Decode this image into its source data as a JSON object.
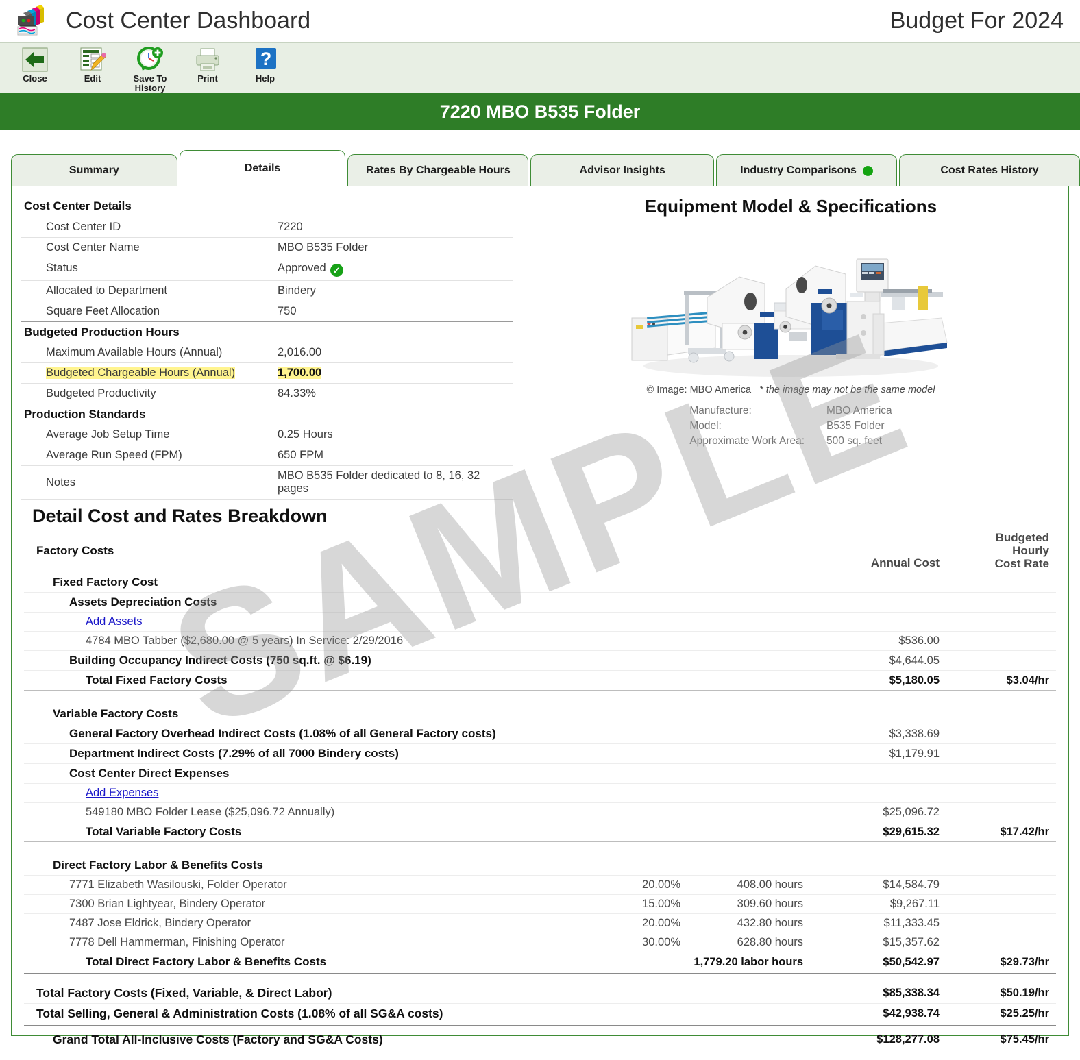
{
  "header": {
    "app_title": "Cost Center Dashboard",
    "budget_title": "Budget For 2024",
    "logo_icon": "printer-cartridges-icon"
  },
  "toolbar": {
    "buttons": [
      {
        "label": "Close",
        "icon": "back-arrow-icon"
      },
      {
        "label": "Edit",
        "icon": "form-pencil-icon"
      },
      {
        "label": "Save To",
        "label2": "History",
        "icon": "clock-plus-icon"
      },
      {
        "label": "Print",
        "icon": "printer-icon"
      },
      {
        "label": "Help",
        "icon": "question-mark-icon"
      }
    ]
  },
  "banner": {
    "title": "7220  MBO B535 Folder"
  },
  "tabs": [
    {
      "label": "Summary",
      "active": false
    },
    {
      "label": "Details",
      "active": true
    },
    {
      "label": "Rates By Chargeable Hours",
      "active": false
    },
    {
      "label": "Advisor Insights",
      "active": false
    },
    {
      "label": "Industry Comparisons",
      "active": false,
      "dot": true
    },
    {
      "label": "Cost Rates History",
      "active": false
    }
  ],
  "cost_center_details": {
    "section_title": "Cost Center Details",
    "rows": [
      {
        "label": "Cost Center ID",
        "value": "7220"
      },
      {
        "label": "Cost Center Name",
        "value": "MBO B535 Folder"
      },
      {
        "label": "Status",
        "value": "Approved",
        "badge": "approved-check-icon"
      },
      {
        "label": "Allocated to Department",
        "value": "Bindery"
      },
      {
        "label": "Square Feet Allocation",
        "value": "750"
      }
    ]
  },
  "budgeted_production_hours": {
    "section_title": "Budgeted Production Hours",
    "rows": [
      {
        "label": "Maximum Available Hours (Annual)",
        "value": "2,016.00",
        "highlight": false
      },
      {
        "label": "Budgeted Chargeable Hours (Annual)",
        "value": "1,700.00",
        "highlight": true
      },
      {
        "label": "Budgeted Productivity",
        "value": "84.33%",
        "highlight": false
      }
    ]
  },
  "production_standards": {
    "section_title": "Production Standards",
    "rows": [
      {
        "label": "Average Job Setup Time",
        "value": "0.25 Hours"
      },
      {
        "label": "Average Run Speed  (FPM)",
        "value": "650 FPM"
      },
      {
        "label": "Notes",
        "value": "MBO B535 Folder dedicated to 8, 16, 32 pages"
      }
    ]
  },
  "equipment": {
    "title": "Equipment Model & Specifications",
    "image_icon": "folding-machine-photo",
    "credit": "© Image: MBO America",
    "credit_note": "* the image may not be the same model",
    "specs": [
      {
        "key": "Manufacture:",
        "value": "MBO America"
      },
      {
        "key": "Model:",
        "value": "B535 Folder"
      },
      {
        "key": "Approximate Work Area:",
        "value": "500 sq. feet"
      }
    ]
  },
  "breakdown": {
    "title": "Detail Cost and Rates Breakdown",
    "group_title": "Factory Costs",
    "col_annual": "Annual Cost",
    "col_rate_l1": "Budgeted",
    "col_rate_l2": "Hourly",
    "col_rate_l3": "Cost Rate",
    "fixed": {
      "title": "Fixed Factory Cost",
      "assets_title": "Assets Depreciation Costs",
      "add_assets_link": "Add Assets",
      "asset_row": {
        "label": "4784 MBO Tabber  ($2,680.00 @ 5 years)   In Service: 2/29/2016",
        "amount": "$536.00"
      },
      "building_row": {
        "label": "Building Occupancy Indirect Costs (750 sq.ft. @ $6.19)",
        "amount": "$4,644.05"
      },
      "total": {
        "label": "Total Fixed Factory Costs",
        "amount": "$5,180.05",
        "rate": "$3.04/hr"
      }
    },
    "variable": {
      "title": "Variable Factory Costs",
      "general_row": {
        "label": "General Factory Overhead Indirect Costs (1.08% of all General Factory costs)",
        "amount": "$3,338.69"
      },
      "department_row": {
        "label": "Department Indirect Costs (7.29% of all 7000 Bindery costs)",
        "amount": "$1,179.91"
      },
      "direct_expenses_title": "Cost Center Direct Expenses",
      "add_expenses_link": "Add Expenses",
      "expense_row": {
        "label": "549180 MBO Folder Lease     ($25,096.72 Annually)",
        "amount": "$25,096.72"
      },
      "total": {
        "label": "Total Variable Factory Costs",
        "amount": "$29,615.32",
        "rate": "$17.42/hr"
      }
    },
    "labor": {
      "title": "Direct Factory Labor & Benefits Costs",
      "rows": [
        {
          "label": "7771 Elizabeth Wasilouski, Folder Operator",
          "pct": "20.00%",
          "hours": "408.00 hours",
          "amount": "$14,584.79"
        },
        {
          "label": "7300 Brian Lightyear, Bindery Operator",
          "pct": "15.00%",
          "hours": "309.60 hours",
          "amount": "$9,267.11"
        },
        {
          "label": "7487 Jose Eldrick, Bindery Operator",
          "pct": "20.00%",
          "hours": "432.80 hours",
          "amount": "$11,333.45"
        },
        {
          "label": "7778 Dell Hammerman, Finishing Operator",
          "pct": "30.00%",
          "hours": "628.80 hours",
          "amount": "$15,357.62"
        }
      ],
      "total": {
        "label": "Total Direct Factory Labor & Benefits Costs",
        "hours": "1,779.20 labor hours",
        "amount": "$50,542.97",
        "rate": "$29.73/hr"
      }
    },
    "totals": [
      {
        "label": "Total Factory Costs (Fixed, Variable, & Direct Labor)",
        "amount": "$85,338.34",
        "rate": "$50.19/hr"
      },
      {
        "label": "Total Selling, General & Administration Costs (1.08% of all SG&A costs)",
        "amount": "$42,938.74",
        "rate": "$25.25/hr"
      }
    ],
    "grand_total": {
      "label": "Grand Total All-Inclusive Costs (Factory and SG&A Costs)",
      "amount": "$128,277.08",
      "rate": "$75.45/hr"
    }
  },
  "watermark": {
    "text": "SAMPLE"
  },
  "colors": {
    "banner_green": "#2e7d27",
    "tab_border": "#3f8c36",
    "link_blue": "#1a17c9",
    "highlight_yellow": "#fff48f",
    "status_green": "#17a117"
  }
}
